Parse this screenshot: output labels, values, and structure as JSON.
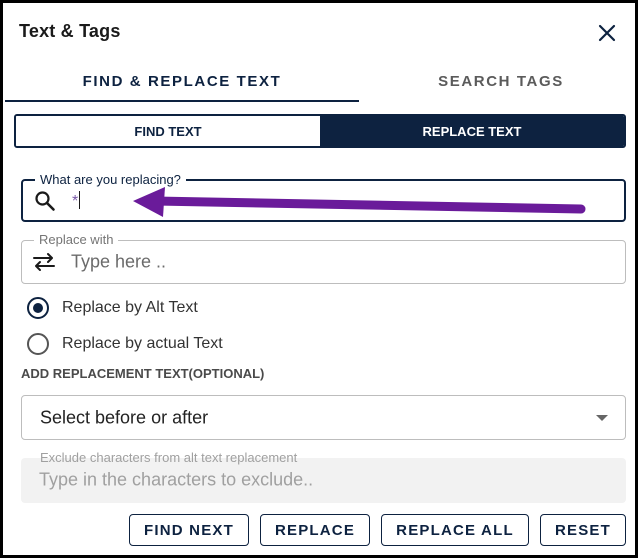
{
  "panel": {
    "title": "Text & Tags"
  },
  "tabs": [
    {
      "label": "FIND & REPLACE TEXT",
      "active": true
    },
    {
      "label": "SEARCH TAGS",
      "active": false
    }
  ],
  "mode_toggle": [
    {
      "label": "FIND TEXT",
      "selected": false
    },
    {
      "label": "REPLACE TEXT",
      "selected": true
    }
  ],
  "find_field": {
    "legend": "What are you replacing?",
    "value": "*",
    "icon": "search-icon"
  },
  "replace_field": {
    "legend": "Replace with",
    "placeholder": "Type here ..",
    "icon": "swap-arrows-icon"
  },
  "radio_options": [
    {
      "label": "Replace by Alt Text",
      "checked": true
    },
    {
      "label": "Replace by actual Text",
      "checked": false
    }
  ],
  "optional_section": {
    "label": "ADD REPLACEMENT TEXT(OPTIONAL)"
  },
  "position_select": {
    "value": "Select before or after"
  },
  "exclude_field": {
    "legend": "Exclude characters from alt text replacement",
    "placeholder": "Type in the characters to exclude.."
  },
  "buttons": {
    "find_next": "FIND NEXT",
    "replace": "REPLACE",
    "replace_all": "REPLACE ALL",
    "reset": "RESET"
  },
  "colors": {
    "primary": "#0d2240",
    "annotation": "#6a1b9a",
    "border": "#bdbdbd"
  }
}
